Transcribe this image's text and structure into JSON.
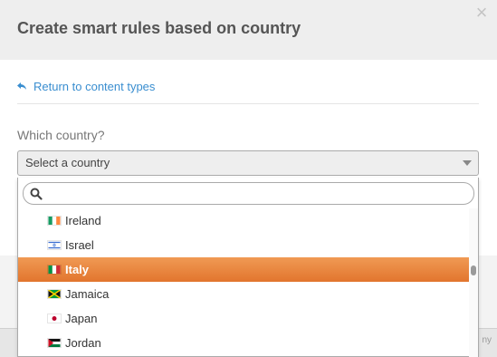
{
  "modal": {
    "title": "Create smart rules based on country",
    "close_icon": "close-icon"
  },
  "back_link": {
    "label": "Return to content types",
    "icon": "reply-arrow-icon"
  },
  "field": {
    "label": "Which country?",
    "select_value": "Select a country"
  },
  "dropdown": {
    "search": {
      "value": "",
      "placeholder": "",
      "icon": "search-icon"
    },
    "options": [
      {
        "label": "Ireland",
        "flag": "ireland-flag-icon"
      },
      {
        "label": "Israel",
        "flag": "israel-flag-icon"
      },
      {
        "label": "Italy",
        "flag": "italy-flag-icon",
        "highlighted": true
      },
      {
        "label": "Jamaica",
        "flag": "jamaica-flag-icon"
      },
      {
        "label": "Japan",
        "flag": "japan-flag-icon"
      },
      {
        "label": "Jordan",
        "flag": "jordan-flag-icon"
      }
    ]
  },
  "background": {
    "fragment": "ny"
  },
  "colors": {
    "accent_link": "#3a8ed0",
    "highlight_top": "#f09a54",
    "highlight_bottom": "#e2752e",
    "header_bg": "#eeeeee"
  }
}
